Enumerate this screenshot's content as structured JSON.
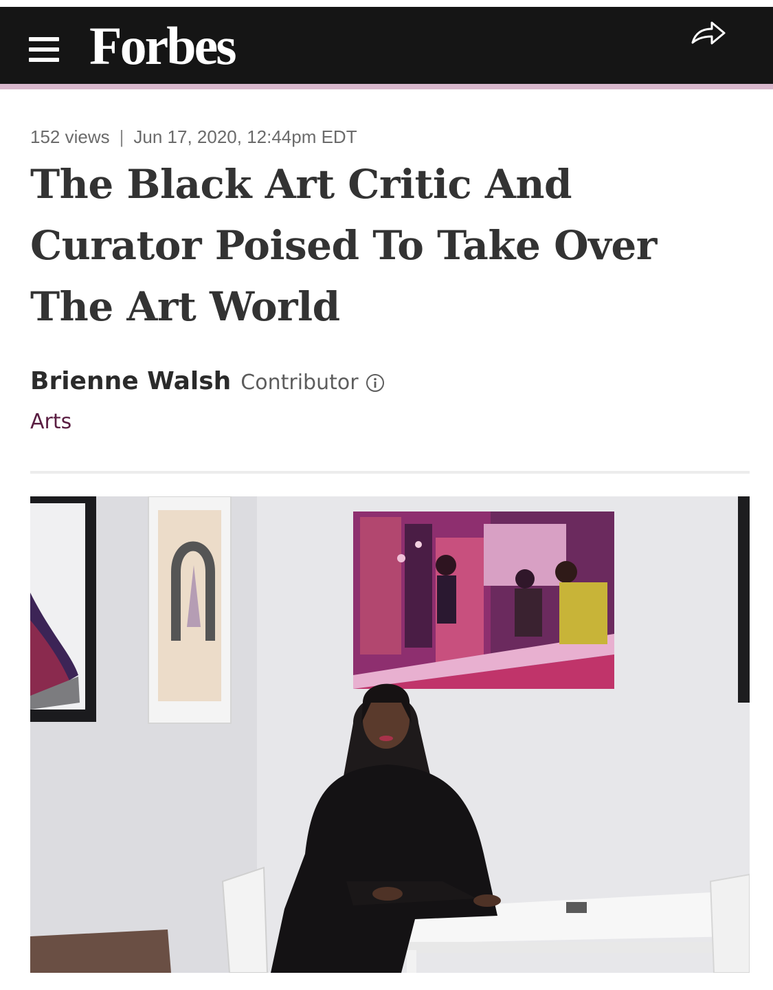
{
  "header": {
    "brand": "Forbes",
    "menu_icon": "hamburger-menu-icon",
    "share_icon": "share-arrow-icon",
    "background_color": "#151515",
    "accent_color": "#d8b7cc"
  },
  "article": {
    "views": "152 views",
    "separator": "|",
    "timestamp": "Jun 17, 2020, 12:44pm EDT",
    "headline": "The Black Art Critic And Curator Poised To Take Over The Art World",
    "author": "Brienne Walsh",
    "author_role": "Contributor",
    "info_icon": "info-circle-icon",
    "section": "Arts",
    "section_color": "#5a1e42"
  }
}
